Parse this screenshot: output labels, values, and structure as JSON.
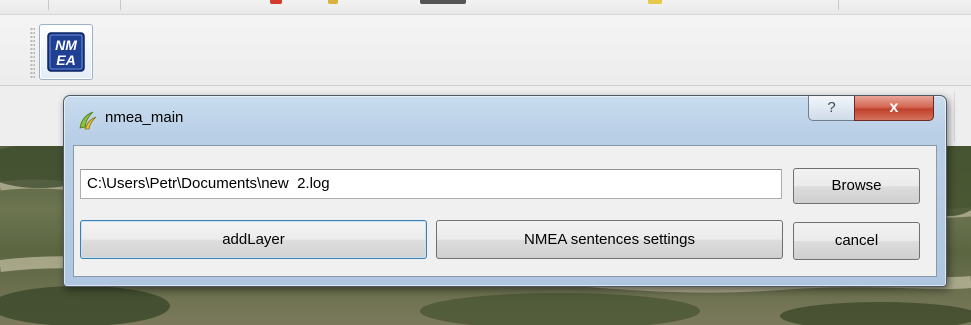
{
  "toolbar": {
    "plugin_icon_text_line1": "NM",
    "plugin_icon_text_line2": "EA"
  },
  "dialog": {
    "title": "nmea_main",
    "help_glyph": "?",
    "close_glyph": "x",
    "path_value": "C:\\Users\\Petr\\Documents\\new  2.log",
    "browse_label": "Browse",
    "add_layer_label": "addLayer",
    "nmea_settings_label": "NMEA sentences settings",
    "cancel_label": "cancel"
  },
  "colors": {
    "title_bar": "#b9cfe6",
    "close_button": "#c8462f",
    "focus_border": "#3c7fb1"
  }
}
